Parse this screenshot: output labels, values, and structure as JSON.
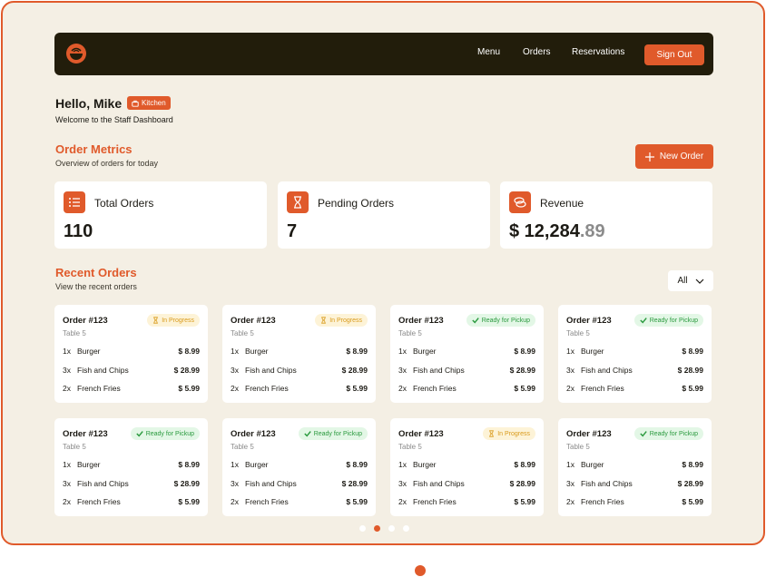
{
  "nav": {
    "links": [
      "Menu",
      "Orders",
      "Reservations"
    ],
    "signout_label": "Sign Out"
  },
  "header": {
    "greeting": "Hello, Mike",
    "role": "Kitchen",
    "welcome": "Welcome to the Staff Dashboard"
  },
  "metrics_section": {
    "title": "Order Metrics",
    "subtitle": "Overview of orders for today",
    "new_order_label": "New Order"
  },
  "metrics": [
    {
      "label": "Total Orders",
      "value": "110",
      "icon": "list-icon"
    },
    {
      "label": "Pending Orders",
      "value": "7",
      "icon": "hourglass-icon"
    },
    {
      "label": "Revenue",
      "value": "$ 12,284",
      "cents": ".89",
      "icon": "coins-icon"
    }
  ],
  "recent_section": {
    "title": "Recent Orders",
    "subtitle": "View the recent orders",
    "filter_value": "All"
  },
  "orders": [
    {
      "title": "Order #123",
      "table": "Table 5",
      "status": "In Progress",
      "status_type": "progress",
      "items": [
        {
          "qty": "1x",
          "name": "Burger",
          "price": "$ 8.99"
        },
        {
          "qty": "3x",
          "name": "Fish and Chips",
          "price": "$ 28.99"
        },
        {
          "qty": "2x",
          "name": "French Fries",
          "price": "$ 5.99"
        }
      ]
    },
    {
      "title": "Order #123",
      "table": "Table 5",
      "status": "In Progress",
      "status_type": "progress",
      "items": [
        {
          "qty": "1x",
          "name": "Burger",
          "price": "$ 8.99"
        },
        {
          "qty": "3x",
          "name": "Fish and Chips",
          "price": "$ 28.99"
        },
        {
          "qty": "2x",
          "name": "French Fries",
          "price": "$ 5.99"
        }
      ]
    },
    {
      "title": "Order #123",
      "table": "Table 5",
      "status": "Ready for Pickup",
      "status_type": "ready",
      "items": [
        {
          "qty": "1x",
          "name": "Burger",
          "price": "$ 8.99"
        },
        {
          "qty": "3x",
          "name": "Fish and Chips",
          "price": "$ 28.99"
        },
        {
          "qty": "2x",
          "name": "French Fries",
          "price": "$ 5.99"
        }
      ]
    },
    {
      "title": "Order #123",
      "table": "Table 5",
      "status": "Ready for Pickup",
      "status_type": "ready",
      "items": [
        {
          "qty": "1x",
          "name": "Burger",
          "price": "$ 8.99"
        },
        {
          "qty": "3x",
          "name": "Fish and Chips",
          "price": "$ 28.99"
        },
        {
          "qty": "2x",
          "name": "French Fries",
          "price": "$ 5.99"
        }
      ]
    },
    {
      "title": "Order #123",
      "table": "Table 5",
      "status": "Ready for Pickup",
      "status_type": "ready",
      "items": [
        {
          "qty": "1x",
          "name": "Burger",
          "price": "$ 8.99"
        },
        {
          "qty": "3x",
          "name": "Fish and Chips",
          "price": "$ 28.99"
        },
        {
          "qty": "2x",
          "name": "French Fries",
          "price": "$ 5.99"
        }
      ]
    },
    {
      "title": "Order #123",
      "table": "Table 5",
      "status": "Ready for Pickup",
      "status_type": "ready",
      "items": [
        {
          "qty": "1x",
          "name": "Burger",
          "price": "$ 8.99"
        },
        {
          "qty": "3x",
          "name": "Fish and Chips",
          "price": "$ 28.99"
        },
        {
          "qty": "2x",
          "name": "French Fries",
          "price": "$ 5.99"
        }
      ]
    },
    {
      "title": "Order #123",
      "table": "Table 5",
      "status": "In Progress",
      "status_type": "progress",
      "items": [
        {
          "qty": "1x",
          "name": "Burger",
          "price": "$ 8.99"
        },
        {
          "qty": "3x",
          "name": "Fish and Chips",
          "price": "$ 28.99"
        },
        {
          "qty": "2x",
          "name": "French Fries",
          "price": "$ 5.99"
        }
      ]
    },
    {
      "title": "Order #123",
      "table": "Table 5",
      "status": "Ready for Pickup",
      "status_type": "ready",
      "items": [
        {
          "qty": "1x",
          "name": "Burger",
          "price": "$ 8.99"
        },
        {
          "qty": "3x",
          "name": "Fish and Chips",
          "price": "$ 28.99"
        },
        {
          "qty": "2x",
          "name": "French Fries",
          "price": "$ 5.99"
        }
      ]
    }
  ],
  "pagination": {
    "pages": 4,
    "active": 1
  },
  "colors": {
    "accent": "#e05a2b",
    "nav_bg": "#221d0b",
    "page_bg": "#f4efe4",
    "ready": "#2a9a3e",
    "progress": "#d99a1b"
  }
}
